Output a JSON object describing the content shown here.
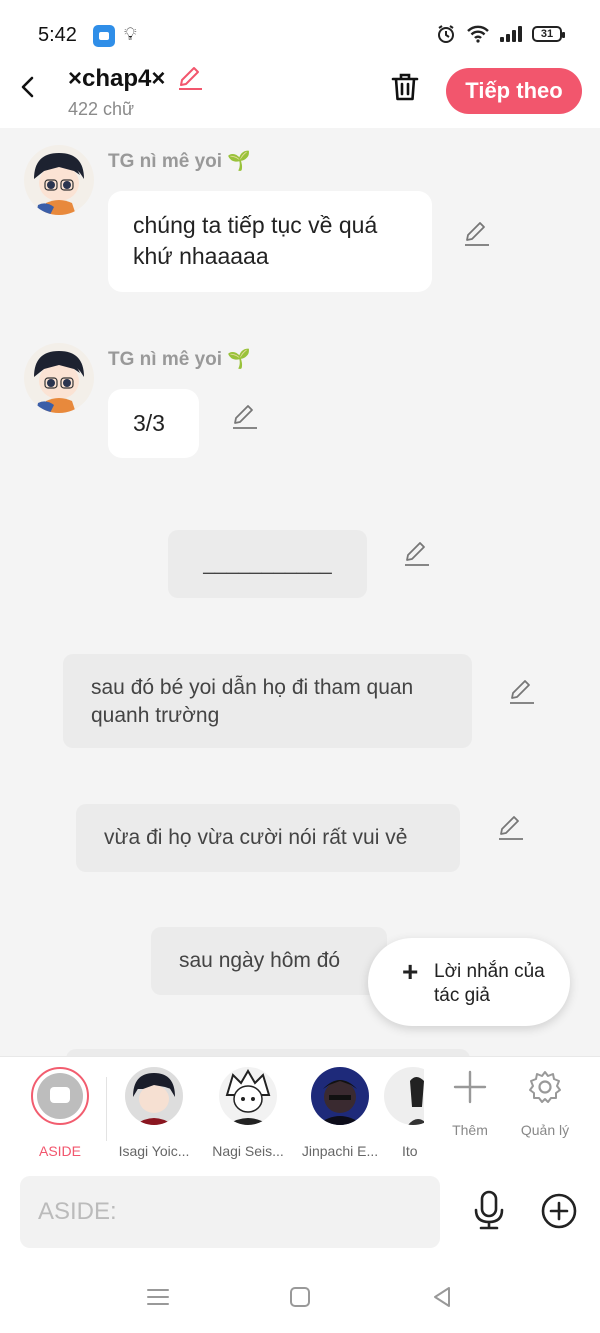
{
  "status": {
    "time": "5:42",
    "battery": "31"
  },
  "header": {
    "title": "×chap4×",
    "subtitle": "422 chữ",
    "next_label": "Tiếp theo"
  },
  "chat": {
    "messages": [
      {
        "author": "TG nì mê yoi 🌱",
        "text": "chúng ta tiếp tục về quá khứ nhaaaaa"
      },
      {
        "author": "TG nì mê yoi 🌱",
        "text": "3/3"
      }
    ],
    "narrations": [
      "___________",
      "sau đó bé yoi dẫn họ đi tham quan quanh trường",
      "vừa đi họ vừa cười nói rất vui vẻ",
      "sau ngày hôm đó"
    ],
    "author_note_button": "Lời nhắn của tác giả"
  },
  "characters": [
    {
      "name": "ASIDE",
      "selected": true
    },
    {
      "name": "Isagi Yoic..."
    },
    {
      "name": "Nagi Seis..."
    },
    {
      "name": "Jinpachi E..."
    },
    {
      "name": "Ito"
    }
  ],
  "tools": {
    "add_label": "Thêm",
    "manage_label": "Quản lý"
  },
  "input": {
    "placeholder": "ASIDE:"
  },
  "colors": {
    "accent": "#f2566d",
    "background": "#f4f4f4"
  }
}
